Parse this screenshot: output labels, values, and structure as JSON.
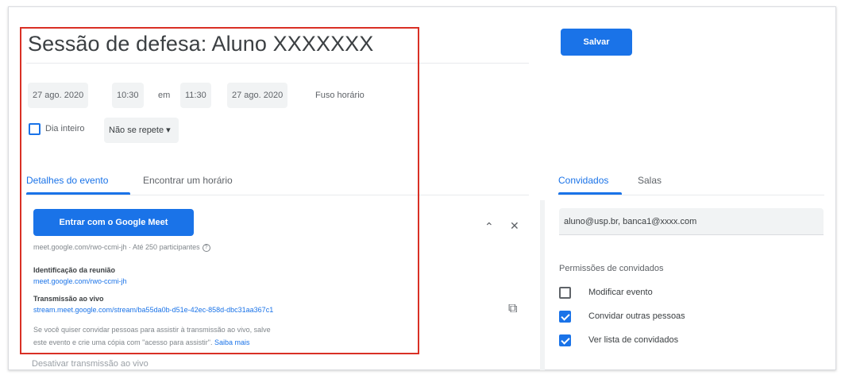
{
  "event": {
    "title": "Sessão de defesa: Aluno XXXXXXX",
    "start_date": "27 ago. 2020",
    "start_time": "10:30",
    "to_word": "em",
    "end_time": "11:30",
    "end_date": "27 ago. 2020",
    "timezone_label": "Fuso horário",
    "allday_label": "Dia inteiro",
    "allday_checked": false,
    "repeat_label": "Não se repete ▾"
  },
  "left_tabs": [
    {
      "label": "Detalhes do evento",
      "active": true
    },
    {
      "label": "Encontrar um horário",
      "active": false
    }
  ],
  "meet": {
    "button_label": "Entrar com o Google Meet",
    "link_line": "meet.google.com/rwo-ccmi-jh · Até 250 participantes",
    "help_glyph": "?",
    "id_title": "Identificação da reunião",
    "id_value": "meet.google.com/rwo-ccmi-jh",
    "live_title": "Transmissão ao vivo",
    "live_value": "stream.meet.google.com/stream/ba55da0b-d51e-42ec-858d-dbc31aa367c1",
    "note_line1": "Se você quiser convidar pessoas para assistir à transmissão ao vivo, salve",
    "note_line2": "este evento e crie uma cópia com \"acesso para assistir\".",
    "learn_more": "Saiba mais",
    "collapse_glyph": "⌃",
    "close_glyph": "✕",
    "copy_glyph": "⧉"
  },
  "cut_off_text": "Desativar transmissão ao vivo",
  "save_label": "Salvar",
  "right_tabs": [
    {
      "label": "Convidados",
      "active": true
    },
    {
      "label": "Salas",
      "active": false
    }
  ],
  "guests_value": "aluno@usp.br, banca1@xxxx.com",
  "permissions": {
    "title": "Permissões de convidados",
    "items": [
      {
        "label": "Modificar evento",
        "checked": false
      },
      {
        "label": "Convidar outras pessoas",
        "checked": true
      },
      {
        "label": "Ver lista de convidados",
        "checked": true
      }
    ]
  },
  "colors": {
    "accent": "#1a73e8",
    "highlight": "#d93025"
  }
}
